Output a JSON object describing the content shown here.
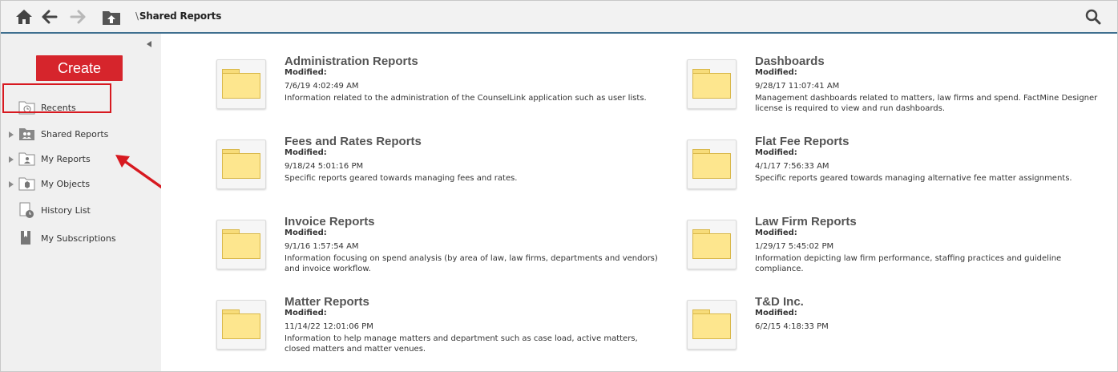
{
  "breadcrumb": {
    "separator": "\\",
    "current": "Shared Reports"
  },
  "sidebar": {
    "create_label": "Create",
    "items": [
      {
        "label": "Recents",
        "icon": "recents-icon",
        "expandable": false
      },
      {
        "label": "Shared Reports",
        "icon": "shared-folder-icon",
        "expandable": true,
        "highlighted": true
      },
      {
        "label": "My Reports",
        "icon": "my-reports-folder-icon",
        "expandable": true
      },
      {
        "label": "My Objects",
        "icon": "my-objects-folder-icon",
        "expandable": true
      },
      {
        "label": "History List",
        "icon": "history-list-icon",
        "expandable": false
      },
      {
        "label": "My Subscriptions",
        "icon": "subscriptions-icon",
        "expandable": false
      }
    ]
  },
  "colors": {
    "create": "#d6252c",
    "highlight": "#d71920",
    "topbar_border": "#3f6f8f",
    "folder": "#fde68e"
  },
  "folders": [
    {
      "name": "Administration Reports",
      "modified_label": "Modified:",
      "date": "7/6/19 4:02:49 AM",
      "description": "Information related to the administration of the CounselLink application such as user lists."
    },
    {
      "name": "Dashboards",
      "modified_label": "Modified:",
      "date": "9/28/17 11:07:41 AM",
      "description": "Management dashboards related to matters, law firms and spend.  FactMine Designer license is required to view and run dashboards."
    },
    {
      "name": "Fees and Rates Reports",
      "modified_label": "Modified:",
      "date": "9/18/24 5:01:16 PM",
      "description": "Specific reports geared towards managing fees and rates."
    },
    {
      "name": "Flat Fee Reports",
      "modified_label": "Modified:",
      "date": "4/1/17 7:56:33 AM",
      "description": "Specific reports geared towards managing alternative fee matter assignments."
    },
    {
      "name": "Invoice Reports",
      "modified_label": "Modified:",
      "date": "9/1/16 1:57:54 AM",
      "description": "Information focusing on spend analysis (by area of law, law firms, departments and vendors) and invoice workflow."
    },
    {
      "name": "Law Firm Reports",
      "modified_label": "Modified:",
      "date": "1/29/17 5:45:02 PM",
      "description": "Information depicting law firm performance, staffing practices and guideline compliance."
    },
    {
      "name": "Matter Reports",
      "modified_label": "Modified:",
      "date": "11/14/22 12:01:06 PM",
      "description": "Information to help manage matters and department such as case load, active matters, closed matters and matter venues."
    },
    {
      "name": "T&D Inc.",
      "modified_label": "Modified:",
      "date": "6/2/15 4:18:33 PM",
      "description": ""
    }
  ]
}
